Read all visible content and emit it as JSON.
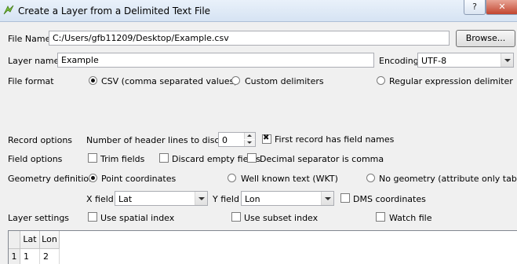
{
  "window": {
    "title": "Create a Layer from a Delimited Text File",
    "help_button": "?",
    "close_button": "✕"
  },
  "file_name": {
    "label": "File Name",
    "value": "C:/Users/gfb11209/Desktop/Example.csv",
    "browse_label": "Browse..."
  },
  "layer_name": {
    "label": "Layer name",
    "value": "Example",
    "encoding_label": "Encoding",
    "encoding_value": "UTF-8"
  },
  "file_format": {
    "label": "File format",
    "options": [
      "CSV (comma separated values)",
      "Custom delimiters",
      "Regular expression delimiter"
    ],
    "selected": "CSV (comma separated values)"
  },
  "record_options": {
    "label": "Record options",
    "header_lines_label": "Number of header lines to discard",
    "header_lines_value": "0",
    "first_record_label": "First record has field names",
    "first_record_checked": true
  },
  "field_options": {
    "label": "Field options",
    "trim_fields": "Trim fields",
    "discard_empty": "Discard empty fields",
    "decimal_comma": "Decimal separator is comma"
  },
  "geometry": {
    "label": "Geometry definition",
    "options": [
      "Point coordinates",
      "Well known text (WKT)",
      "No geometry (attribute only table)"
    ],
    "selected": "Point coordinates",
    "x_field_label": "X field",
    "x_field_value": "Lat",
    "y_field_label": "Y field",
    "y_field_value": "Lon",
    "dms_label": "DMS coordinates"
  },
  "layer_settings": {
    "label": "Layer settings",
    "spatial_index": "Use spatial index",
    "subset_index": "Use subset index",
    "watch_file": "Watch file"
  },
  "preview_table": {
    "columns": [
      "Lat",
      "Lon"
    ],
    "rows": [
      {
        "row_header": "1",
        "cells": [
          "1",
          "2"
        ]
      }
    ]
  }
}
